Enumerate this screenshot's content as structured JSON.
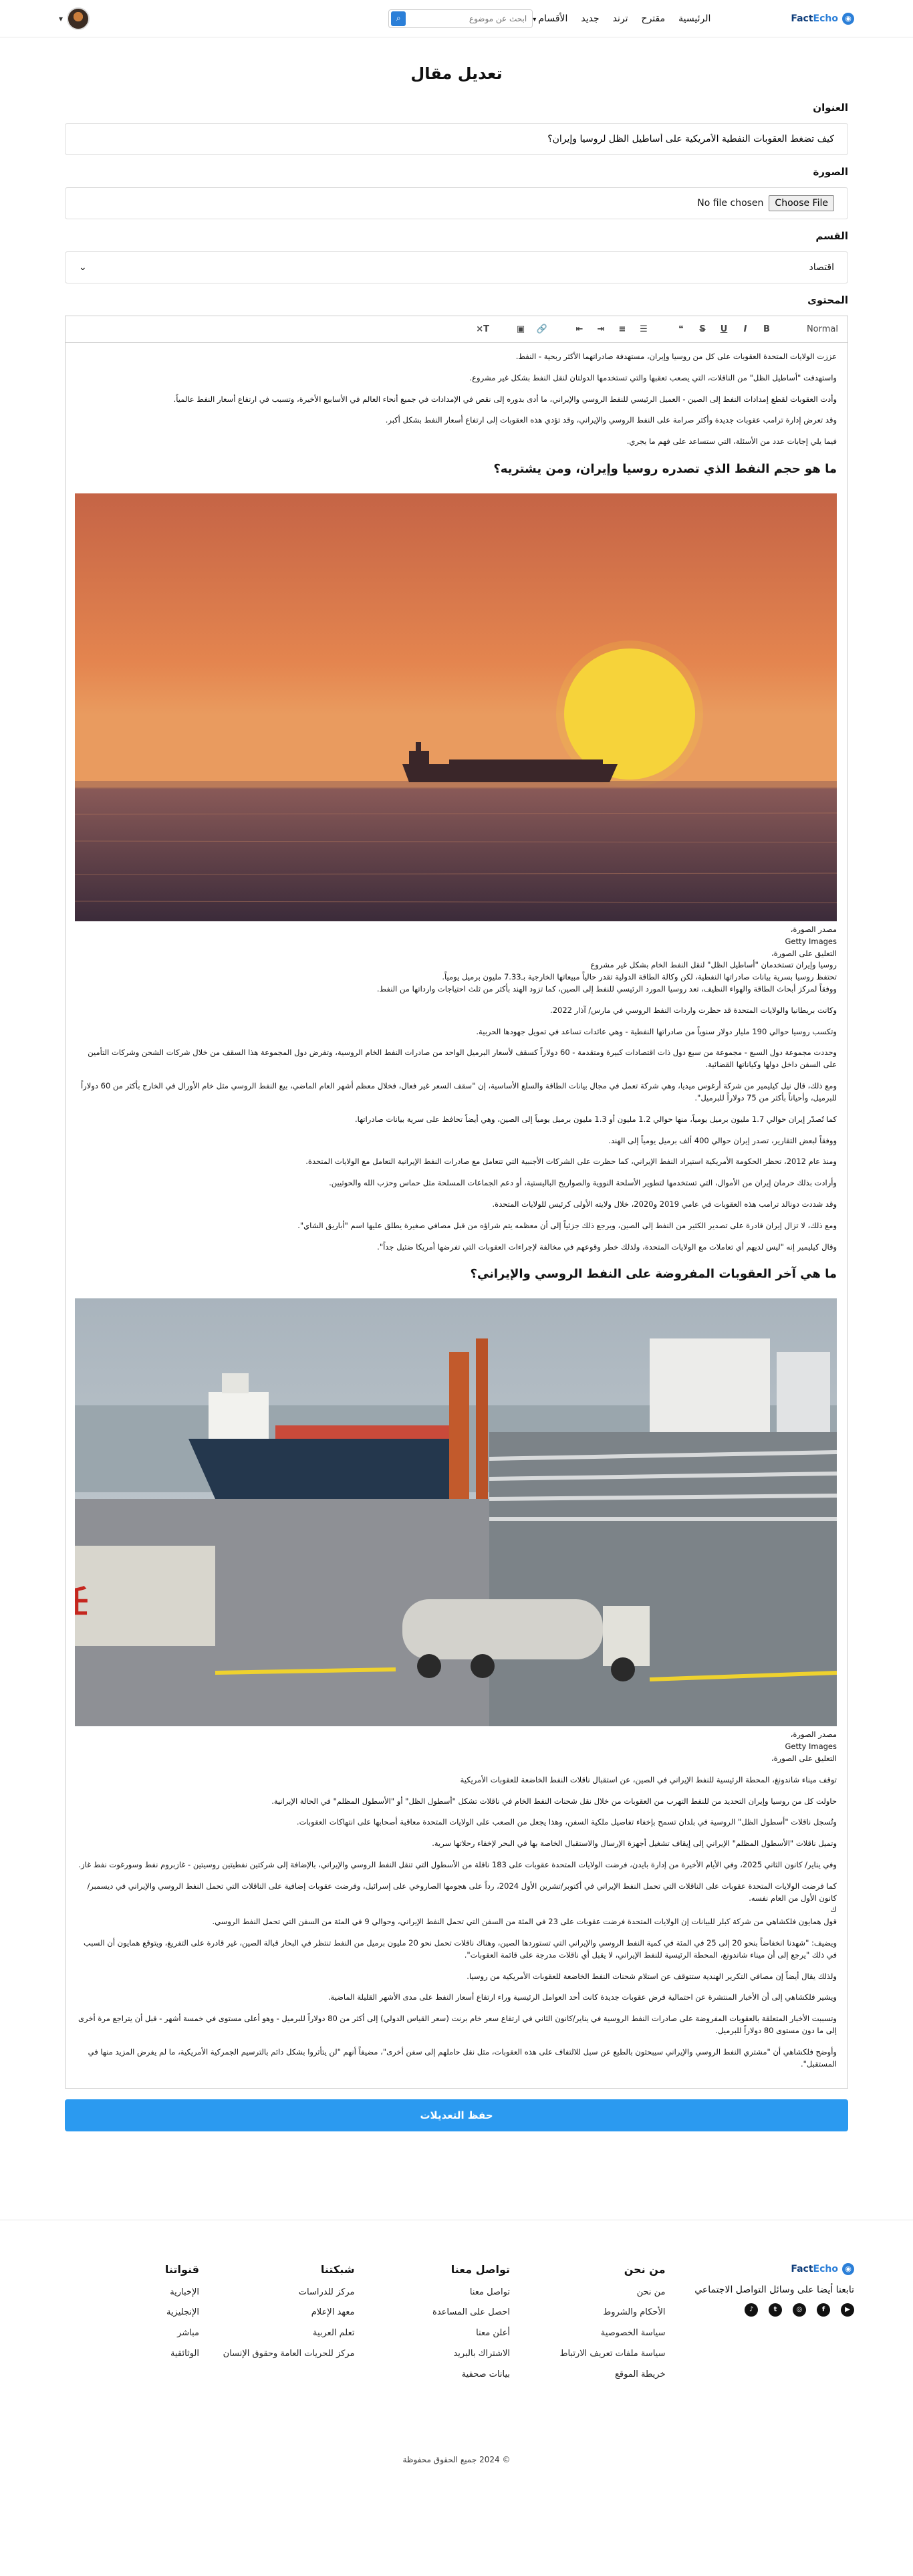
{
  "header": {
    "logo": {
      "fact": "Fact",
      "echo": "Echo"
    },
    "nav": {
      "home": "الرئيسية",
      "suggested": "مقترح",
      "trend": "ترند",
      "new": "جديد",
      "sections": "الأقسام"
    },
    "search_placeholder": "ابحث عن موضوع"
  },
  "page": {
    "title": "تعديل مقال"
  },
  "form": {
    "title_label": "العنوان",
    "title_value": "كيف تضغط العقوبات النفطية الأمريكية على أساطيل الظل لروسيا وإيران؟",
    "image_label": "الصورة",
    "file_button": "Choose File",
    "file_status": "No file chosen",
    "category_label": "القسم",
    "category_value": "اقتصاد",
    "content_label": "المحتوى",
    "heading_select": "Normal",
    "save_button": "حفظ التعديلات"
  },
  "article": {
    "intro": [
      "عززت الولايات المتحدة العقوبات على كل من روسيا وإيران، مستهدفة صادراتهما الأكثر ربحية - النفط.",
      "واستهدفت \"أساطيل الظل\" من الناقلات، التي يصعب تعقبها والتي تستخدمها الدولتان لنقل النفط بشكل غير مشروع.",
      "وأدت العقوبات لقطع إمدادات النفط إلى الصين - العميل الرئيسي للنفط الروسي والإيراني، ما أدى بدوره إلى نقص في الإمدادات في جميع أنحاء العالم في الأسابيع الأخيرة، وتسبب في ارتفاع أسعار النفط عالمياً.",
      "وقد تعرض إدارة ترامب عقوبات جديدة وأكثر صرامة على النفط الروسي والإيراني، وقد تؤدي هذه العقوبات إلى ارتفاع أسعار النفط بشكل أكبر.",
      "فيما يلي إجابات عدد من الأسئلة، التي ستساعد على فهم ما يجري."
    ],
    "heading1": "ما هو حجم النفط الذي تصدره روسيا وإيران، ومن يشتريه؟",
    "caption1": [
      "مصدر الصورة،",
      "Getty Images",
      "التعليق على الصورة،",
      "روسيا وإيران تستخدمان \"أساطيل الظل\" لنقل النفط الخام بشكل غير مشروع",
      "تحتفظ روسيا بسرية بيانات صادراتها النفطية، لكن وكالة الطاقة الدولية تقدر حالياً مبيعاتها الخارجية بـ7.33 مليون برميل يومياً.",
      "ووفقاً لمركز أبحاث الطاقة والهواء النظيف، تعد روسيا المورد الرئيسي للنفط إلى الصين، كما تزود الهند بأكثر من ثلث احتياجات وارداتها من النفط."
    ],
    "section1": [
      "وكانت بريطانيا والولايات المتحدة قد حظرت واردات النفط الروسي في مارس/ آذار 2022.",
      "وتكسب روسيا حوالي 190 مليار دولار سنوياً من صادراتها النفطية - وهي عائدات تساعد في تمويل جهودها الحربية.",
      "وحددت مجموعة دول السبع - مجموعة من سبع دول ذات اقتصادات كبيرة ومتقدمة - 60 دولاراً كسقف لأسعار البرميل الواحد من صادرات النفط الخام الروسية، وتفرض دول المجموعة هذا السقف من خلال شركات الشحن وشركات التأمين على السفن داخل دولها وكياناتها القضائية.",
      "ومع ذلك، قال نيل كيليمير من شركة أرغوس ميديا، وهي شركة تعمل في مجال بيانات الطاقة والسلع الأساسية، إن \"سقف السعر غير فعال، فخلال معظم أشهر العام الماضي، بيع النفط الروسي مثل خام الأورال في الخارج بأكثر من 60 دولاراً للبرميل، وأحياناً بأكثر من 75 دولاراً للبرميل\".",
      "كما تُصدّر إيران حوالي 1.7 مليون برميل يومياً، منها حوالي 1.2 مليون أو 1.3 مليون برميل يومياً إلى الصين، وهي أيضاً تحافظ على سرية بيانات صادراتها.",
      "ووفقاً لبعض التقارير، تصدر إيران حوالي 400 ألف برميل يومياً إلى الهند.",
      "ومنذ عام 2012، تحظر الحكومة الأمريكية استيراد النفط الإيراني، كما حظرت على الشركات الأجنبية التي تتعامل مع صادرات النفط الإيرانية التعامل مع الولايات المتحدة.",
      "وأرادت بذلك حرمان إيران من الأموال، التي تستخدمها لتطوير الأسلحة النووية والصواريخ الباليستية، أو دعم الجماعات المسلحة مثل حماس وحزب الله والحوثيين.",
      "وقد شددت دونالد ترامب هذه العقوبات في عامي 2019 و2020، خلال ولايته الأولى كرئيس للولايات المتحدة.",
      "ومع ذلك، لا تزال إيران قادرة على تصدير الكثير من النفط إلى الصين، ويرجع ذلك جزئياً إلى أن معظمه يتم شراؤه من قبل مصافي صغيرة يطلق عليها اسم \"أباريق الشاي\".",
      "وقال كيليمير إنه \"ليس لديهم أي تعاملات مع الولايات المتحدة، ولذلك خطر وقوعهم في مخالفة لإجراءات العقوبات التي تفرضها أمريكا ضئيل جداً\"."
    ],
    "heading2": "ما هي آخر العقوبات المفروضة على النفط الروسي والإيراني؟",
    "caption2": [
      "مصدر الصورة،",
      "Getty Images",
      "التعليق على الصورة،"
    ],
    "section2": [
      "توقف ميناء شاندونغ، المحطة الرئيسية للنفط الإيراني في الصين، عن استقبال ناقلات النفط الخاضعة للعقوبات الأمريكية",
      "حاولت كل من روسيا وإيران التحديد من للنفط التهرب من العقوبات من خلال نقل شحنات النفط الخام في ناقلات تشكل \"أسطول الظل\" أو \"الأسطول المظلم\" في الحالة الإيرانية.",
      "وتُسجل ناقلات \"أسطول الظل\" الروسية في بلدان تسمح بإخفاء تفاصيل ملكية السفن، وهذا يجعل من الصعب على الولايات المتحدة معاقبة أصحابها على انتهاكات العقوبات.",
      "وتميل ناقلات \"الأسطول المظلم\" الإيراني إلى إيقاف تشغيل أجهزة الإرسال والاستقبال الخاصة بها في البحر لإخفاء رحلاتها سرية.",
      "وفي يناير/ كانون الثاني 2025، وفي الأيام الأخيرة من إدارة بايدن، فرضت الولايات المتحدة عقوبات على 183 ناقلة من الأسطول التي تنقل النفط الروسي والإيراني، بالإضافة إلى شركتين نفطيتين روسيتين - غازبروم نفط وسورغوت نفط غاز.",
      "كما فرضت الولايات المتحدة عقوبات على الناقلات التي تحمل النفط الإيراني في أكتوبر/تشرين الأول 2024، رداً على هجومها الصاروخي على إسرائيل، وفرضت عقوبات إضافية على الناقلات التي تحمل النفط الروسي والإيراني في ديسمبر/كانون الأول من العام نفسه.",
      "ك",
      "قول همايون فلكشاهي من شركة كبلر للبيانات إن الولايات المتحدة فرضت عقوبات على 23 في المئة من السفن التي تحمل النفط الإيراني، وحوالي 9 في المئة من السفن التي تحمل النفط الروسي.",
      "ويضيف: \"شهدنا انخفاضاً بنحو 20 إلى 25 في المئة في كمية النفط الروسي والإيراني التي تستوردها الصين، وهناك ناقلات تحمل نحو 20 مليون برميل من النفط تنتظر في البحار قبالة الصين، غير قادرة على التفريغ، ويتوقع همايون أن السبب في ذلك \"يرجع إلى أن ميناء شاندونغ، المحطة الرئيسية للنفط الإيراني، لا يقبل أي ناقلات مدرجة على قائمة العقوبات\".",
      "ولذلك يقال أيضاً إن مصافي التكرير الهندية ستتوقف عن استلام شحنات النفط الخاضعة للعقوبات الأمريكية من روسيا.",
      "ويشير فلكشاهي إلى أن الأخبار المنتشرة عن احتمالية فرض عقوبات جديدة كانت أحد العوامل الرئيسية وراء ارتفاع أسعار النفط على مدى الأشهر القليلة الماضية.",
      "وتسببت الأخبار المتعلقة بالعقوبات المفروضة على صادرات النفط الروسية في يناير/كانون الثاني في ارتفاع سعر خام برنت (سعر القياس الدولي) إلى أكثر من 80 دولاراً للبرميل - وهو أعلى مستوى في خمسة أشهر - قبل أن يتراجع مرة أخرى إلى ما دون مستوى 80 دولاراً للبرميل.",
      "وأوضح فلكشاهي أن \"مشتري النفط الروسي والإيراني سيبحثون بالطبع عن سبل للالتفاف على هذه العقوبات، مثل نقل حاملهم إلى سفن أخرى\"، مضيفاً أنهم \"لن يتأثروا بشكل دائم بالترسيم الجمركية الأمريكية، ما لم يفرض المزيد منها في المستقبل\"."
    ]
  },
  "footer": {
    "brand": {
      "fact": "Fact",
      "echo": "Echo"
    },
    "follow_text": "تابعنا أيضا على وسائل التواصل الاجتماعي",
    "about": {
      "title": "من نحن",
      "links": [
        "من نحن",
        "الأحكام والشروط",
        "سياسة الخصوصية",
        "سياسة ملفات تعريف الارتباط",
        "خريطة الموقع"
      ]
    },
    "contact": {
      "title": "تواصل معنا",
      "links": [
        "تواصل معنا",
        "احصل على المساعدة",
        "أعلن معنا",
        "الاشتراك بالبريد",
        "بيانات صحفية"
      ]
    },
    "network": {
      "title": "شبكتنا",
      "links": [
        "مركز للدراسات",
        "معهد الإعلام",
        "تعلم العربية",
        "مركز للحريات العامة وحقوق الإنسان"
      ]
    },
    "channels": {
      "title": "قنواتنا",
      "links": [
        "الإخبارية",
        "الإنجليزية",
        "مباشر",
        "الوثائقية"
      ]
    },
    "copyright": "© 2024 جميع الحقوق محفوظة"
  }
}
